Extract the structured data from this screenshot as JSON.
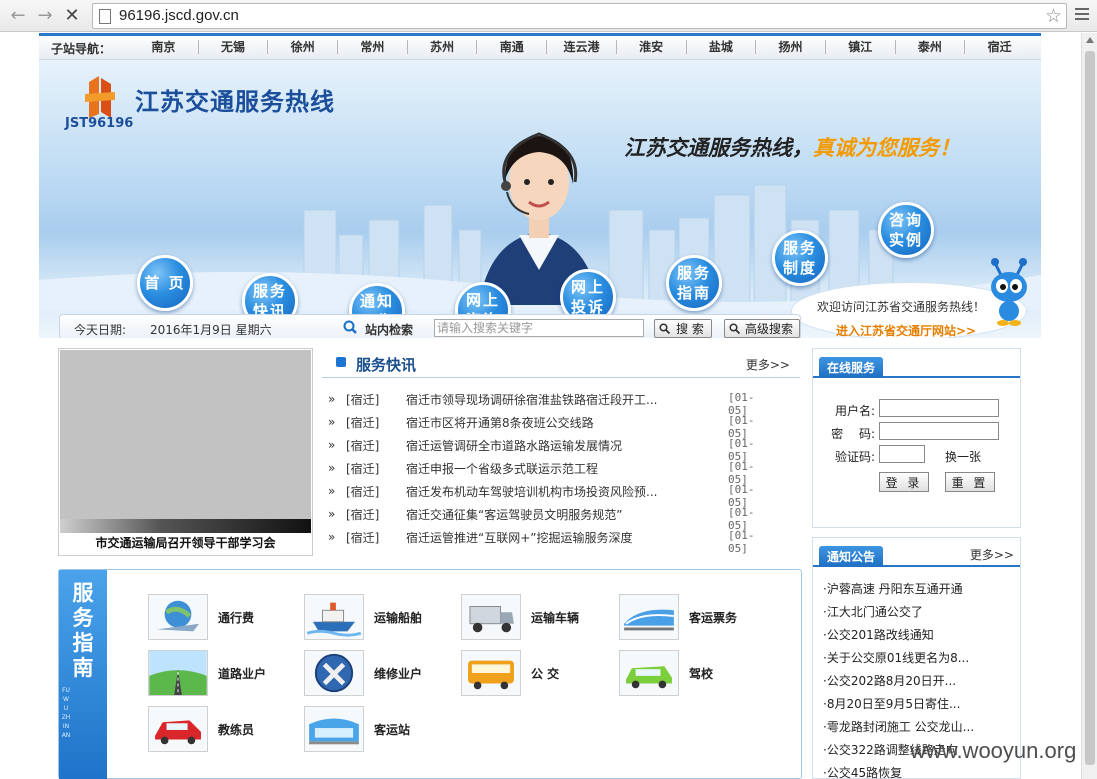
{
  "browser": {
    "url": "96196.jscd.gov.cn",
    "back": "←",
    "forward": "→",
    "stop": "✕"
  },
  "citynav": {
    "label": "子站导航：",
    "cities": [
      "南京",
      "无锡",
      "徐州",
      "常州",
      "苏州",
      "南通",
      "连云港",
      "淮安",
      "盐城",
      "扬州",
      "镇江",
      "泰州",
      "宿迁"
    ]
  },
  "banner": {
    "logo_sub": "JST96196",
    "site_name": "江苏交通服务热线",
    "slogan_main": "江苏交通服务热线，",
    "slogan_highlight": "真诚为您服务！",
    "menu": [
      {
        "label": "首 页"
      },
      {
        "label": "服务 快讯"
      },
      {
        "label": "通知 公告"
      },
      {
        "label": "网上 咨询"
      },
      {
        "label": "网上 投诉"
      },
      {
        "label": "服务 指南"
      },
      {
        "label": "服务 制度"
      },
      {
        "label": "咨询 实例"
      }
    ],
    "welcome": "欢迎访问江苏省交通服务热线！",
    "welcome_link": "进入江苏省交通厅网站>>"
  },
  "searchbar": {
    "date_label": "今天日期:",
    "date_value": "2016年1月9日  星期六",
    "search_label": "站内检索",
    "placeholder": "请输入搜索关键字",
    "search_button": "搜 索",
    "advanced_button": "高级搜索"
  },
  "photo": {
    "caption": "市交通运输局召开领导干部学习会"
  },
  "news": {
    "title": "服务快讯",
    "more": "更多>>",
    "items": [
      {
        "bullet": "»",
        "city": "[宿迁]",
        "title": "宿迁市领导现场调研徐宿淮盐铁路宿迁段开工...",
        "date": "[01-05]"
      },
      {
        "bullet": "»",
        "city": "[宿迁]",
        "title": "宿迁市区将开通第8条夜班公交线路",
        "date": "[01-05]"
      },
      {
        "bullet": "»",
        "city": "[宿迁]",
        "title": "宿迁运管调研全市道路水路运输发展情况",
        "date": "[01-05]"
      },
      {
        "bullet": "»",
        "city": "[宿迁]",
        "title": "宿迁申报一个省级多式联运示范工程",
        "date": "[01-05]"
      },
      {
        "bullet": "»",
        "city": "[宿迁]",
        "title": "宿迁发布机动车驾驶培训机构市场投资风险预...",
        "date": "[01-05]"
      },
      {
        "bullet": "»",
        "city": "[宿迁]",
        "title": "宿迁交通征集“客运驾驶员文明服务规范”",
        "date": "[01-05]"
      },
      {
        "bullet": "»",
        "city": "[宿迁]",
        "title": "宿迁运管推进“互联网+”挖掘运输服务深度",
        "date": "[01-05]"
      }
    ]
  },
  "guide": {
    "side_title": "服务指南",
    "side_sub": "FUWU ZHINAN",
    "items": [
      {
        "label": "通行费",
        "icon": "globe-plane-icon"
      },
      {
        "label": "运输船舶",
        "icon": "ship-icon"
      },
      {
        "label": "运输车辆",
        "icon": "truck-icon"
      },
      {
        "label": "客运票务",
        "icon": "train-icon"
      },
      {
        "label": "道路业户",
        "icon": "road-icon"
      },
      {
        "label": "维修业户",
        "icon": "tools-icon"
      },
      {
        "label": "公 交",
        "icon": "bus-icon"
      },
      {
        "label": "驾校",
        "icon": "car-icon"
      },
      {
        "label": "教练员",
        "icon": "red-car-icon"
      },
      {
        "label": "客运站",
        "icon": "station-icon"
      }
    ]
  },
  "login": {
    "title": "在线服务",
    "username_label": "用户名:",
    "password_label": "密　 码:",
    "captcha_label": "验证码:",
    "captcha_refresh": "换一张",
    "login_button": "登 录",
    "reset_button": "重 置"
  },
  "notices": {
    "title": "通知公告",
    "more": "更多>>",
    "items": [
      "·沪蓉高速 丹阳东互通开通",
      "·江大北门通公交了",
      "·公交201路改线通知",
      "·关于公交原01线更名为8...",
      "·公交202路8月20日开...",
      "·8月20日至9月5日寄住...",
      "·雩龙路封闭施工 公交龙山...",
      "·公交322路调整线路走向",
      "·公交45路恢复"
    ]
  },
  "watermark": "www.wooyun.org",
  "colors": {
    "accent": "#2877c7",
    "link_orange": "#e67e00",
    "brand_blue": "#1b4f9b"
  }
}
